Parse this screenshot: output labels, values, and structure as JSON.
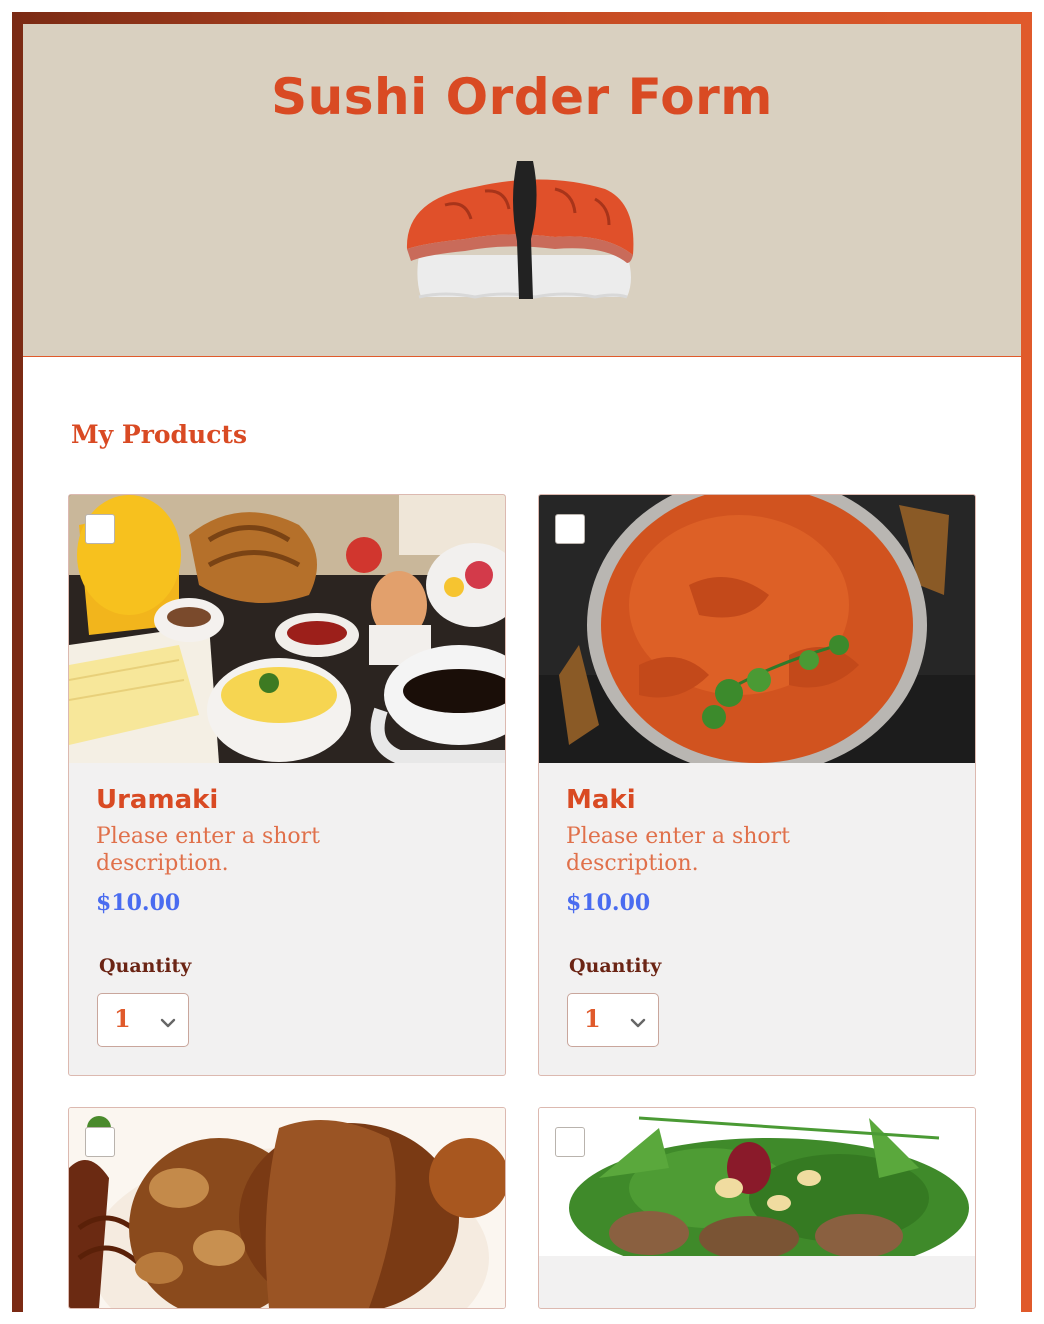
{
  "form": {
    "title": "Sushi Order Form",
    "logo_icon": "sushi-nigiri-icon"
  },
  "products_section": {
    "heading": "My Products",
    "items": [
      {
        "name": "Uramaki",
        "description": "Please enter a short description.",
        "price": "$10.00",
        "quantity_label": "Quantity",
        "quantity_value": "1",
        "image_subject": "breakfast table with croissants, orange juice, coffee and scrambled eggs",
        "checked": false
      },
      {
        "name": "Maki",
        "description": "Please enter a short description.",
        "price": "$10.00",
        "quantity_label": "Quantity",
        "quantity_value": "1",
        "image_subject": "curry in a metal pan with cilantro",
        "checked": false
      },
      {
        "image_subject": "glazed roasted meat with mushrooms",
        "checked": false
      },
      {
        "image_subject": "green salad with pine nuts and beetroot",
        "checked": false
      }
    ]
  },
  "colors": {
    "accent": "#d94a23",
    "header_bg": "#d9d0c0",
    "price": "#4a6cf0",
    "card_bg": "#f2f1f1"
  }
}
